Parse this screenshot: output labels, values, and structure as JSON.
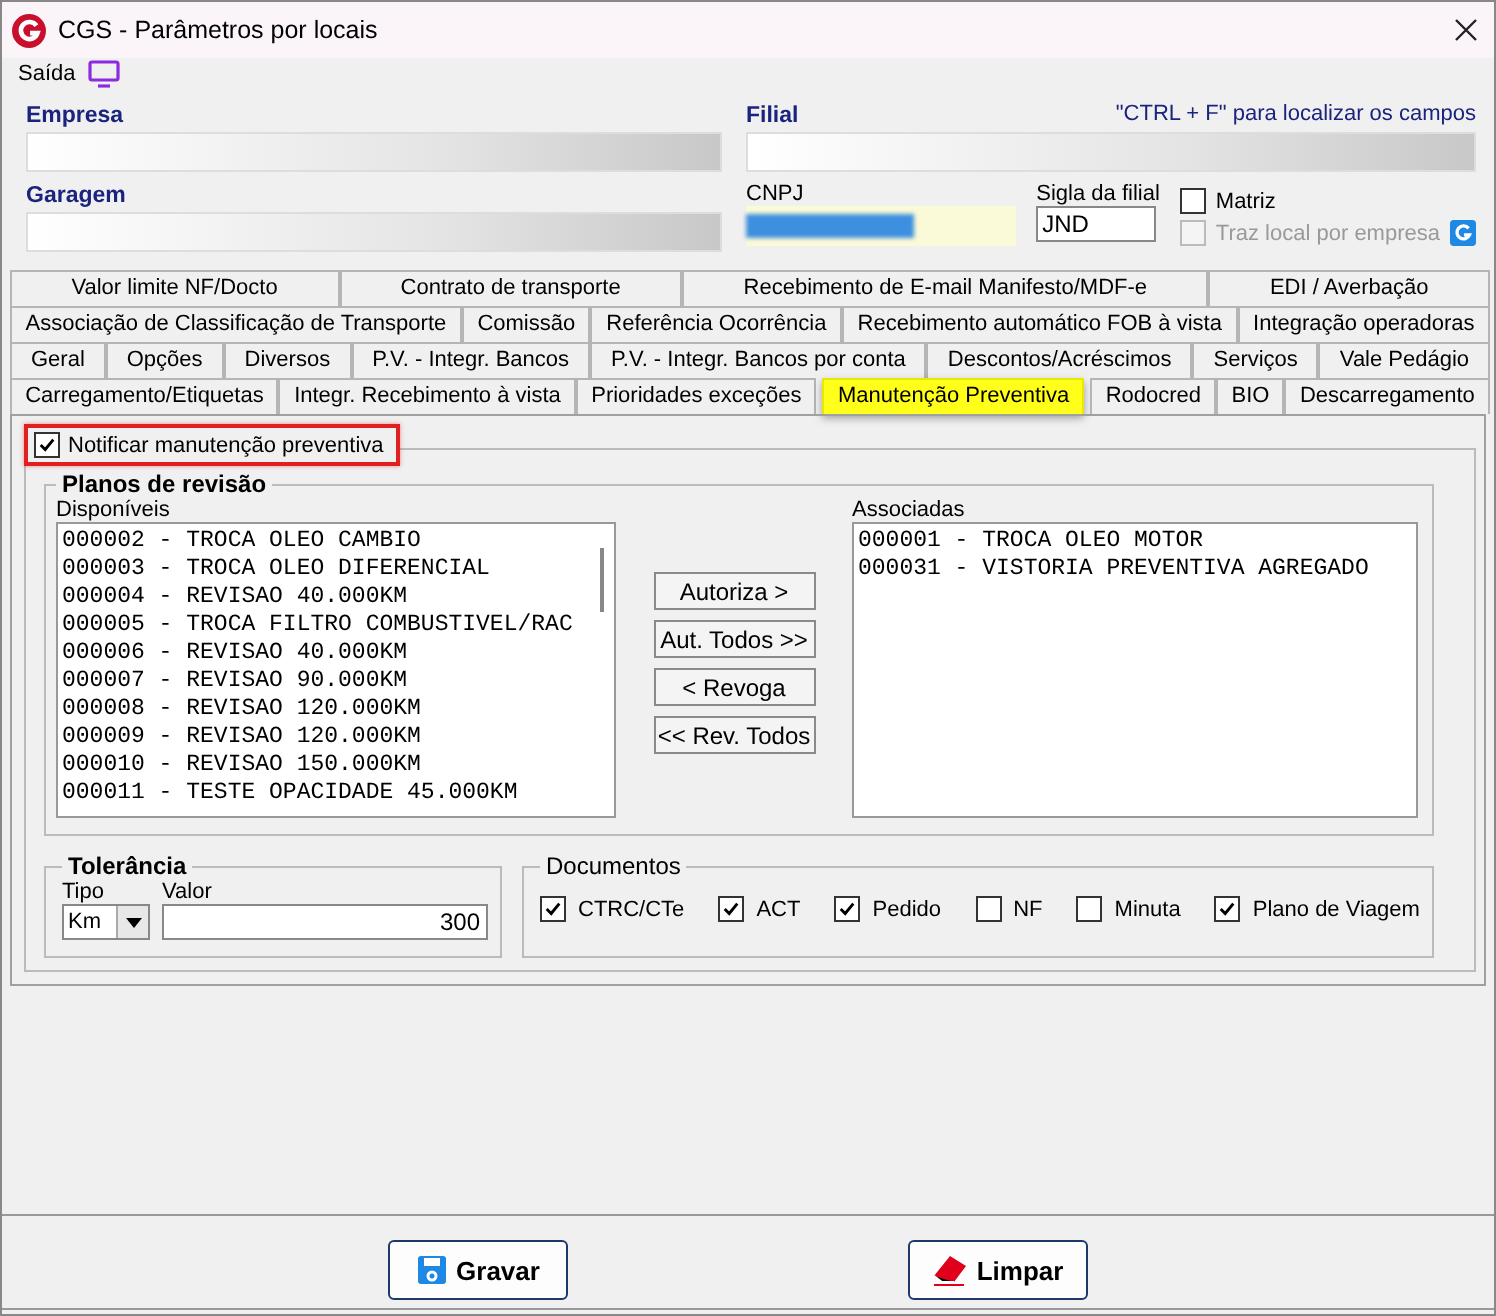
{
  "window": {
    "title": "CGS - Parâmetros por locais"
  },
  "menu": [
    {
      "label": "Saída"
    }
  ],
  "header": {
    "empresa_label": "Empresa",
    "filial_label": "Filial",
    "hint": "\"CTRL + F\" para localizar os campos",
    "garagem_label": "Garagem",
    "cnpj_label": "CNPJ",
    "sigla_label": "Sigla da filial",
    "sigla_value": "JND",
    "options": [
      {
        "label": "Matriz",
        "checked": false,
        "disabled": false
      },
      {
        "label": "Traz local por empresa",
        "checked": false,
        "disabled": true
      }
    ]
  },
  "tab_rows": [
    [
      {
        "label": "Valor limite NF/Docto",
        "selected": false
      },
      {
        "label": "Contrato de transporte",
        "selected": false
      },
      {
        "label": "Recebimento de E-mail Manifesto/MDF-e",
        "selected": false
      },
      {
        "label": "EDI / Averbação",
        "selected": false
      }
    ],
    [
      {
        "label": "Associação de Classificação de Transporte",
        "selected": false
      },
      {
        "label": "Comissão",
        "selected": false
      },
      {
        "label": "Referência Ocorrência",
        "selected": false
      },
      {
        "label": "Recebimento automático FOB à vista",
        "selected": false
      },
      {
        "label": "Integração operadoras",
        "selected": false
      }
    ],
    [
      {
        "label": "Geral",
        "selected": false
      },
      {
        "label": "Opções",
        "selected": false
      },
      {
        "label": "Diversos",
        "selected": false
      },
      {
        "label": "P.V. - Integr. Bancos",
        "selected": false
      },
      {
        "label": "P.V. - Integr. Bancos por conta",
        "selected": false
      },
      {
        "label": "Descontos/Acréscimos",
        "selected": false
      },
      {
        "label": "Serviços",
        "selected": false
      },
      {
        "label": "Vale Pedágio",
        "selected": false
      }
    ],
    [
      {
        "label": "Carregamento/Etiquetas",
        "selected": false
      },
      {
        "label": "Integr. Recebimento à vista",
        "selected": false
      },
      {
        "label": "Prioridades exceções",
        "selected": false
      },
      {
        "label": "Manutenção Preventiva",
        "selected": true
      },
      {
        "label": "Rodocred",
        "selected": false
      },
      {
        "label": "BIO",
        "selected": false
      },
      {
        "label": "Descarregamento",
        "selected": false
      }
    ]
  ],
  "notify": {
    "label": "Notificar manutenção preventiva",
    "checked": true,
    "highlighted": true
  },
  "plans": {
    "title": "Planos de revisão",
    "available_label": "Disponíveis",
    "available": [
      "000002 - TROCA OLEO CAMBIO",
      "000003 - TROCA OLEO DIFERENCIAL",
      "000004 - REVISAO 40.000KM",
      "000005 - TROCA FILTRO COMBUSTIVEL/RAC",
      "000006 - REVISAO 40.000KM",
      "000007 - REVISAO 90.000KM",
      "000008 - REVISAO 120.000KM",
      "000009 - REVISAO 120.000KM",
      "000010 - REVISAO 150.000KM",
      "000011 - TESTE OPACIDADE 45.000KM"
    ],
    "buttons": [
      "Autoriza >",
      "Aut. Todos >>",
      "< Revoga",
      "<< Rev. Todos"
    ],
    "associated_label": "Associadas",
    "associated": [
      "000001 - TROCA OLEO MOTOR",
      "000031 - VISTORIA PREVENTIVA AGREGADO"
    ]
  },
  "tolerance": {
    "title": "Tolerância",
    "tipo_label": "Tipo",
    "tipo_value": "Km",
    "valor_label": "Valor",
    "valor_value": "300"
  },
  "documents": {
    "title": "Documentos",
    "items": [
      {
        "label": "CTRC/CTe",
        "checked": true
      },
      {
        "label": "ACT",
        "checked": true
      },
      {
        "label": "Pedido",
        "checked": true
      },
      {
        "label": "NF",
        "checked": false
      },
      {
        "label": "Minuta",
        "checked": false
      },
      {
        "label": "Plano de Viagem",
        "checked": true
      }
    ]
  },
  "buttons": [
    {
      "label": "Gravar",
      "kind": "save"
    },
    {
      "label": "Limpar",
      "kind": "clear"
    }
  ]
}
